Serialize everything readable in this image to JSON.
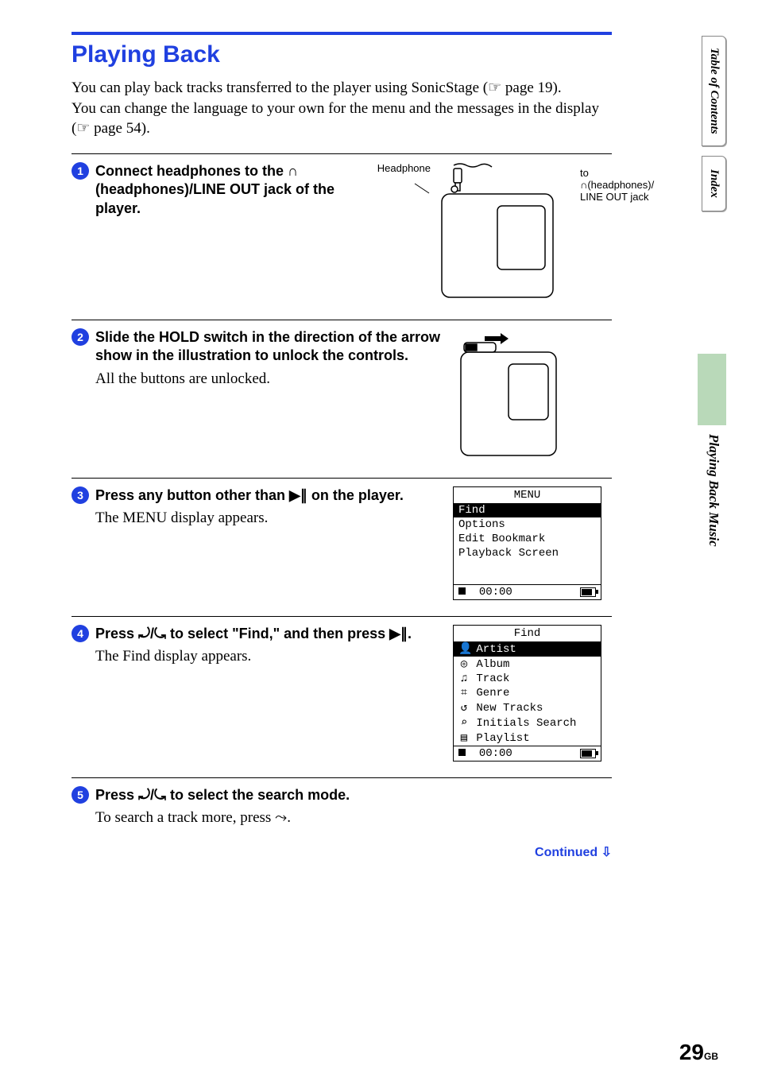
{
  "page": {
    "section_title": "Playing Back",
    "intro_line1a": "You can play back tracks transferred to the player using SonicStage (",
    "intro_line1_ref": "page 19).",
    "intro_line2a": "You can change the language to your own for the menu and the messages in the display (",
    "intro_line2_ref": "page 54).",
    "continued": "Continued",
    "page_number": "29",
    "page_suffix": "GB"
  },
  "side": {
    "toc": "Table of\nContents",
    "index": "Index",
    "section": "Playing Back Music"
  },
  "steps": {
    "s1": {
      "num": "1",
      "heading_a": "Connect headphones to the ",
      "heading_b": " (headphones)/LINE OUT jack of the player.",
      "fig_headphone": "Headphone",
      "fig_to_a": "to ",
      "fig_to_b": "(headphones)/",
      "fig_to_c": "LINE OUT jack"
    },
    "s2": {
      "num": "2",
      "heading": "Slide the HOLD switch in the direction of the arrow show in the illustration to unlock the controls.",
      "desc": "All the buttons are unlocked."
    },
    "s3": {
      "num": "3",
      "heading_a": "Press any button other than ",
      "heading_b": " on the player.",
      "desc": "The MENU display appears.",
      "lcd": {
        "title": "MENU",
        "items": [
          "Find",
          "Options",
          "Edit Bookmark",
          "Playback Screen"
        ],
        "time": "00:00"
      }
    },
    "s4": {
      "num": "4",
      "heading_a": "Press ",
      "heading_b": " to select \"Find,\" and then press ",
      "heading_c": ".",
      "desc": "The Find display appears.",
      "lcd": {
        "title": "Find",
        "items": [
          {
            "icon": "👤",
            "label": "Artist",
            "sel": true
          },
          {
            "icon": "◎",
            "label": "Album"
          },
          {
            "icon": "♫",
            "label": "Track"
          },
          {
            "icon": "⌗",
            "label": "Genre"
          },
          {
            "icon": "↺",
            "label": "New Tracks"
          },
          {
            "icon": "⌕",
            "label": "Initials Search"
          },
          {
            "icon": "▤",
            "label": "Playlist"
          }
        ],
        "time": "00:00"
      }
    },
    "s5": {
      "num": "5",
      "heading_a": "Press ",
      "heading_b": " to select the search mode.",
      "desc_a": "To search a track more, press ",
      "desc_b": "."
    }
  },
  "glyphs": {
    "headphones": "♫",
    "pointer": "☞",
    "play_pause": "▶∥",
    "jog": "↺/↻",
    "right": "▶"
  }
}
